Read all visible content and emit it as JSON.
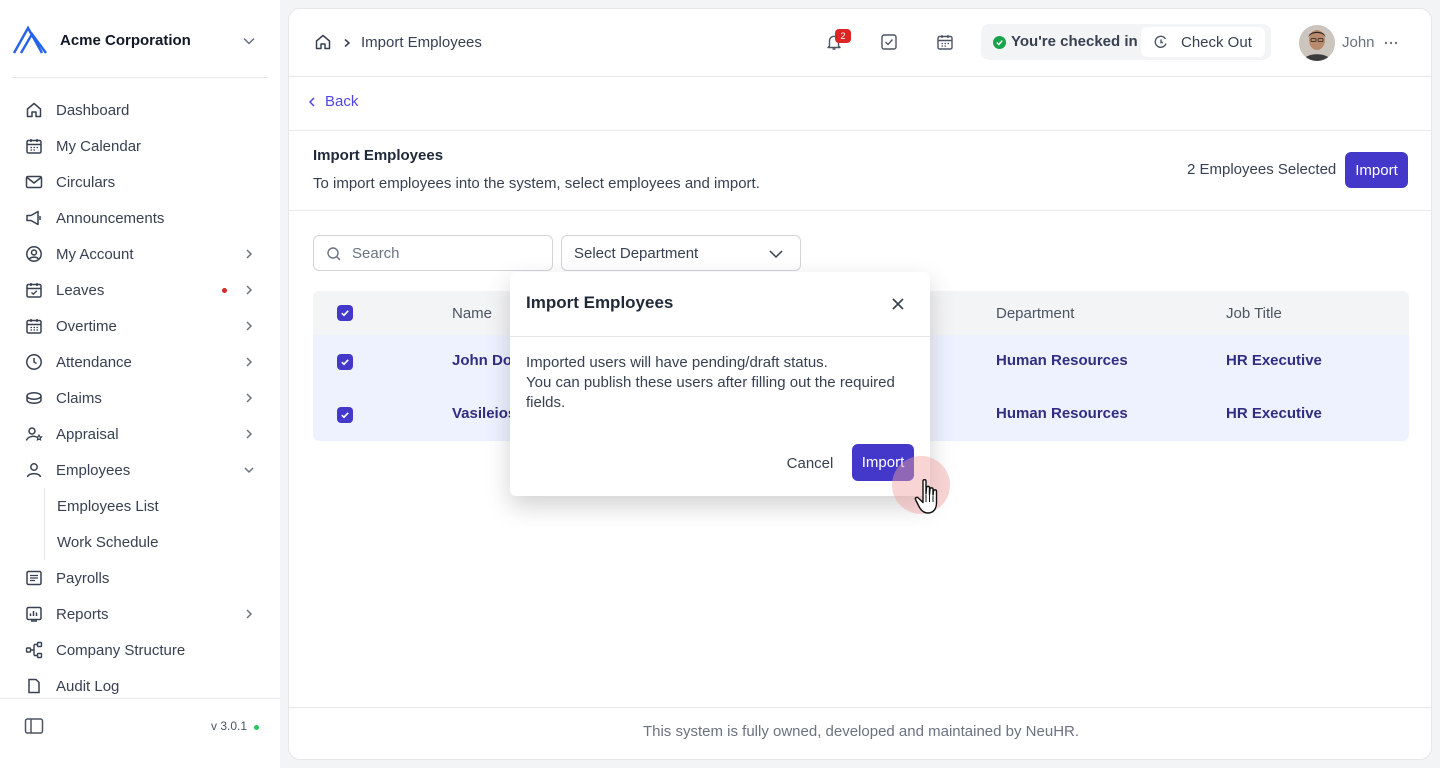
{
  "org": {
    "name": "Acme Corporation"
  },
  "sidebar": {
    "items": [
      {
        "label": "Dashboard",
        "icon": "home-icon"
      },
      {
        "label": "My Calendar",
        "icon": "calendar-icon"
      },
      {
        "label": "Circulars",
        "icon": "mail-icon"
      },
      {
        "label": "Announcements",
        "icon": "megaphone-icon"
      },
      {
        "label": "My Account",
        "icon": "user-circle-icon"
      },
      {
        "label": "Leaves",
        "icon": "calendar-check-icon"
      },
      {
        "label": "Overtime",
        "icon": "calendar-clock-icon"
      },
      {
        "label": "Attendance",
        "icon": "clock-icon"
      },
      {
        "label": "Claims",
        "icon": "coins-icon"
      },
      {
        "label": "Appraisal",
        "icon": "user-star-icon"
      },
      {
        "label": "Employees",
        "icon": "user-icon"
      },
      {
        "label": "Payrolls",
        "icon": "receipt-icon"
      },
      {
        "label": "Reports",
        "icon": "report-icon"
      },
      {
        "label": "Company Structure",
        "icon": "org-chart-icon"
      },
      {
        "label": "Audit Log",
        "icon": "audit-icon"
      }
    ],
    "employees_sub": [
      {
        "label": "Employees List"
      },
      {
        "label": "Work Schedule"
      }
    ],
    "version": "v 3.0.1"
  },
  "topbar": {
    "breadcrumb_current": "Import Employees",
    "notification_count": "2",
    "checkin_status": "You're checked in",
    "checkout_label": "Check Out",
    "user_name": "John"
  },
  "page": {
    "back_label": "Back",
    "title": "Import Employees",
    "description": "To import employees into the system, select employees and import.",
    "selected_count": "2 Employees Selected",
    "import_label": "Import"
  },
  "filters": {
    "search_placeholder": "Search",
    "department_placeholder": "Select Department"
  },
  "table": {
    "columns": [
      "Name",
      "Department",
      "Job Title"
    ],
    "rows": [
      {
        "name": "John Doe",
        "department": "Human Resources",
        "job_title": "HR Executive"
      },
      {
        "name": "Vasileios",
        "department": "Human Resources",
        "job_title": "HR Executive"
      }
    ]
  },
  "modal": {
    "title": "Import Employees",
    "body_line1": "Imported users will have pending/draft status.",
    "body_line2": "You can publish these users after filling out the required fields.",
    "cancel_label": "Cancel",
    "import_label": "Import"
  },
  "footer": {
    "text": "This system is fully owned, developed and maintained by NeuHR."
  },
  "colors": {
    "accent": "#4338ca",
    "link": "#4f46e5",
    "danger": "#dc2626",
    "success": "#16a34a",
    "row_selected": "#eef2ff"
  }
}
